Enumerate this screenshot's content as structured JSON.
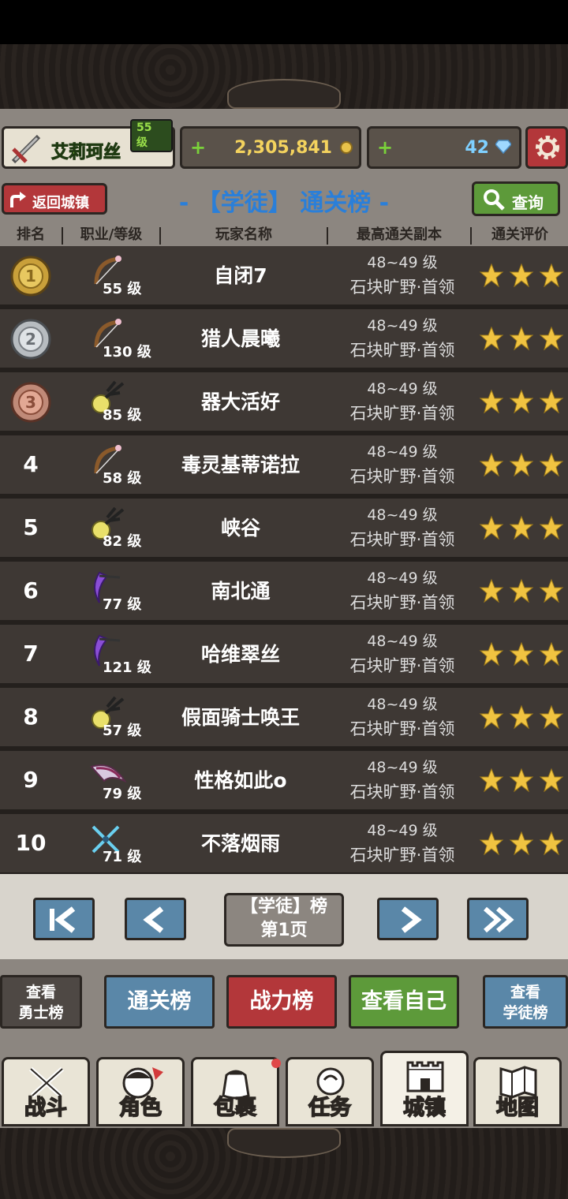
{
  "player": {
    "name": "艾莉珂丝",
    "level": "55 级",
    "gold": "2,305,841",
    "gems": "42"
  },
  "header": {
    "return_label": "返回城镇",
    "title": "- 【学徒】 通关榜 -",
    "query_label": "查询"
  },
  "columns": [
    "排名",
    "职业/等级",
    "玩家名称",
    "最高通关副本",
    "通关评价"
  ],
  "rows": [
    {
      "rank": "1",
      "class": "bow",
      "level": "55 级",
      "name": "自闭7",
      "dungeon_level": "48~49 级",
      "dungeon": "石块旷野·首领",
      "stars": 3
    },
    {
      "rank": "2",
      "class": "bow",
      "level": "130 级",
      "name": "猎人晨曦",
      "dungeon_level": "48~49 级",
      "dungeon": "石块旷野·首领",
      "stars": 3
    },
    {
      "rank": "3",
      "class": "orb",
      "level": "85 级",
      "name": "器大活好",
      "dungeon_level": "48~49 级",
      "dungeon": "石块旷野·首领",
      "stars": 3
    },
    {
      "rank": "4",
      "class": "bow",
      "level": "58 级",
      "name": "毒灵基蒂诺拉",
      "dungeon_level": "48~49 级",
      "dungeon": "石块旷野·首领",
      "stars": 3
    },
    {
      "rank": "5",
      "class": "orb",
      "level": "82 级",
      "name": "峡谷",
      "dungeon_level": "48~49 级",
      "dungeon": "石块旷野·首领",
      "stars": 3
    },
    {
      "rank": "6",
      "class": "scythe",
      "level": "77 级",
      "name": "南北通",
      "dungeon_level": "48~49 级",
      "dungeon": "石块旷野·首领",
      "stars": 3
    },
    {
      "rank": "7",
      "class": "scythe",
      "level": "121 级",
      "name": "哈维翠丝",
      "dungeon_level": "48~49 级",
      "dungeon": "石块旷野·首领",
      "stars": 3
    },
    {
      "rank": "8",
      "class": "orb",
      "level": "57 级",
      "name": "假面骑士唤王",
      "dungeon_level": "48~49 级",
      "dungeon": "石块旷野·首领",
      "stars": 3
    },
    {
      "rank": "9",
      "class": "blade",
      "level": "79 级",
      "name": "性格如此o",
      "dungeon_level": "48~49 级",
      "dungeon": "石块旷野·首领",
      "stars": 3
    },
    {
      "rank": "10",
      "class": "daggers",
      "level": "71 级",
      "name": "不落烟雨",
      "dungeon_level": "48~49 级",
      "dungeon": "石块旷野·首领",
      "stars": 3
    }
  ],
  "pager": {
    "line1": "【学徒】榜",
    "line2": "第1页"
  },
  "actions": {
    "view_warrior": [
      "查看",
      "勇士榜"
    ],
    "clear_board": "通关榜",
    "power_board": "战力榜",
    "view_self": "查看自己",
    "view_apprentice": [
      "查看",
      "学徒榜"
    ]
  },
  "nav": [
    {
      "label": "战斗",
      "icon": "crossed-swords-icon"
    },
    {
      "label": "角色",
      "icon": "character-face-icon"
    },
    {
      "label": "包裹",
      "icon": "bag-icon"
    },
    {
      "label": "任务",
      "icon": "quest-scroll-icon"
    },
    {
      "label": "城镇",
      "icon": "castle-icon"
    },
    {
      "label": "地图",
      "icon": "map-icon"
    }
  ],
  "colors": {
    "accent_blue": "#2a7fd9",
    "red": "#b3373a",
    "green": "#5d9a3a",
    "steel_blue": "#5a87a8",
    "gold_text": "#f4d35e",
    "level_green": "#8ed63d"
  }
}
